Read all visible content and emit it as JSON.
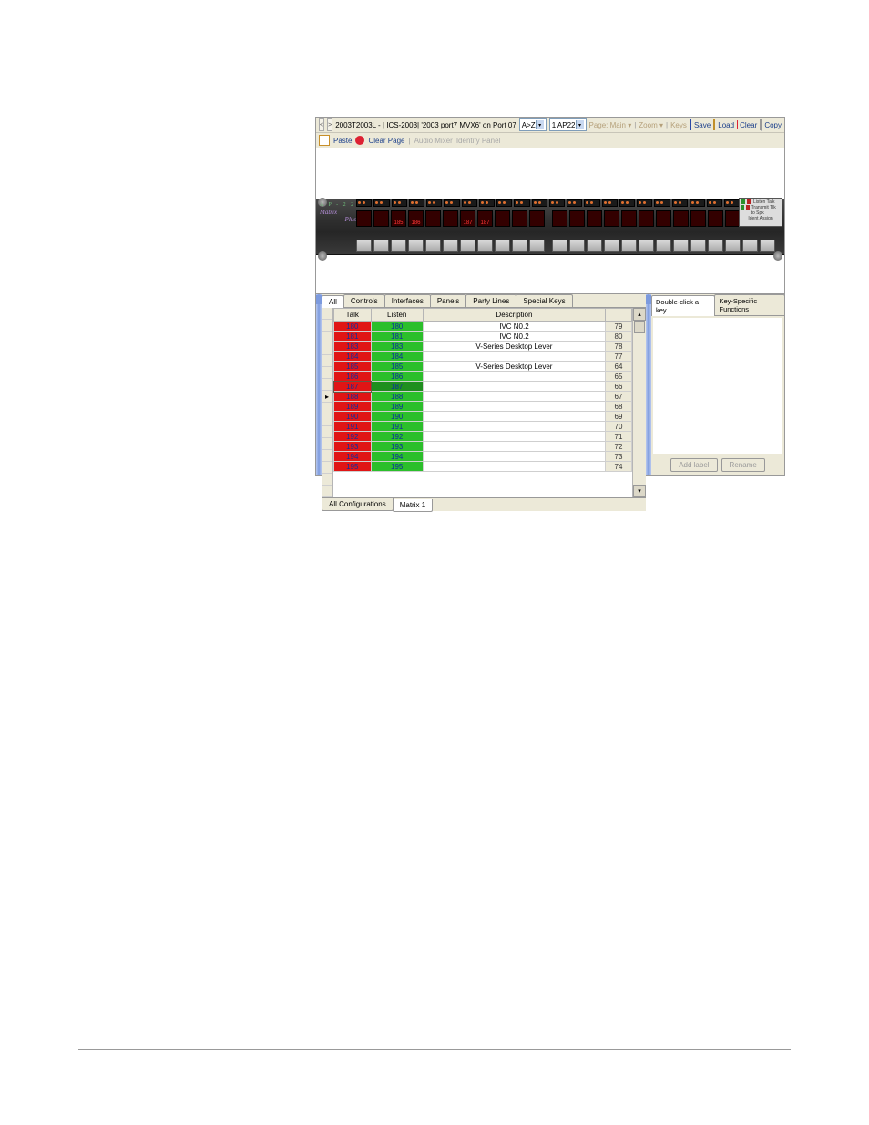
{
  "toolbar1": {
    "back": "<",
    "fwd": ">",
    "crumb": "2003T2003L - | ICS-2003| '2003 port7 MVX6' on Port 07",
    "sort_label": "A>Z",
    "dd1": "1 AP22",
    "page_label": "Page: Main ▾",
    "zoom": "Zoom ▾",
    "keys": "Keys",
    "save": "Save",
    "load": "Load",
    "clear": "Clear",
    "copy": "Copy"
  },
  "toolbar2": {
    "paste": "Paste",
    "clearpage": "Clear Page",
    "audiomixer": "Audio Mixer",
    "identify": "Identify Panel"
  },
  "device": {
    "brand_top": "A P - 2 2",
    "brand1": "Matrix",
    "brand2": "Plus",
    "badge1": "Listen  Talk",
    "badge2": "Transmit Tlk to Spk",
    "badge3": "Ident   Assign",
    "slots": [
      "",
      "",
      "185",
      "186",
      "",
      "",
      "187",
      "187",
      "",
      "",
      "",
      "",
      "",
      "",
      "",
      "",
      "",
      "",
      "",
      "",
      "",
      "",
      "",
      ""
    ]
  },
  "left": {
    "tabs": [
      "All",
      "Controls",
      "Interfaces",
      "Panels",
      "Party Lines",
      "Special Keys"
    ],
    "active": 0,
    "columns": {
      "talk": "Talk",
      "listen": "Listen",
      "desc": "Description",
      "num": ""
    },
    "rows": [
      {
        "talk": "180",
        "listen": "180",
        "desc": "IVC N0.2",
        "num": "79"
      },
      {
        "talk": "181",
        "listen": "181",
        "desc": "IVC N0.2",
        "num": "80"
      },
      {
        "talk": "183",
        "listen": "183",
        "desc": "V-Series Desktop Lever",
        "num": "78"
      },
      {
        "talk": "184",
        "listen": "184",
        "desc": "",
        "num": "77"
      },
      {
        "talk": "185",
        "listen": "185",
        "desc": "V-Series Desktop Lever",
        "num": "64"
      },
      {
        "talk": "186",
        "listen": "186",
        "desc": "",
        "num": "65"
      },
      {
        "talk": "187",
        "listen": "187",
        "desc": "",
        "num": "66",
        "selected": true
      },
      {
        "talk": "188",
        "listen": "188",
        "desc": "",
        "num": "67"
      },
      {
        "talk": "189",
        "listen": "189",
        "desc": "",
        "num": "68"
      },
      {
        "talk": "190",
        "listen": "190",
        "desc": "",
        "num": "69"
      },
      {
        "talk": "191",
        "listen": "191",
        "desc": "",
        "num": "70"
      },
      {
        "talk": "192",
        "listen": "192",
        "desc": "",
        "num": "71"
      },
      {
        "talk": "193",
        "listen": "193",
        "desc": "",
        "num": "72"
      },
      {
        "talk": "194",
        "listen": "194",
        "desc": "",
        "num": "73"
      },
      {
        "talk": "195",
        "listen": "195",
        "desc": "",
        "num": "74"
      }
    ],
    "bottom_tabs": [
      "All Configurations",
      "Matrix 1"
    ],
    "bottom_active": 1
  },
  "right": {
    "tabs": [
      "Double-click a key…",
      "Key-Specific Functions"
    ],
    "active": 0,
    "add_label": "Add label",
    "rename": "Rename"
  }
}
